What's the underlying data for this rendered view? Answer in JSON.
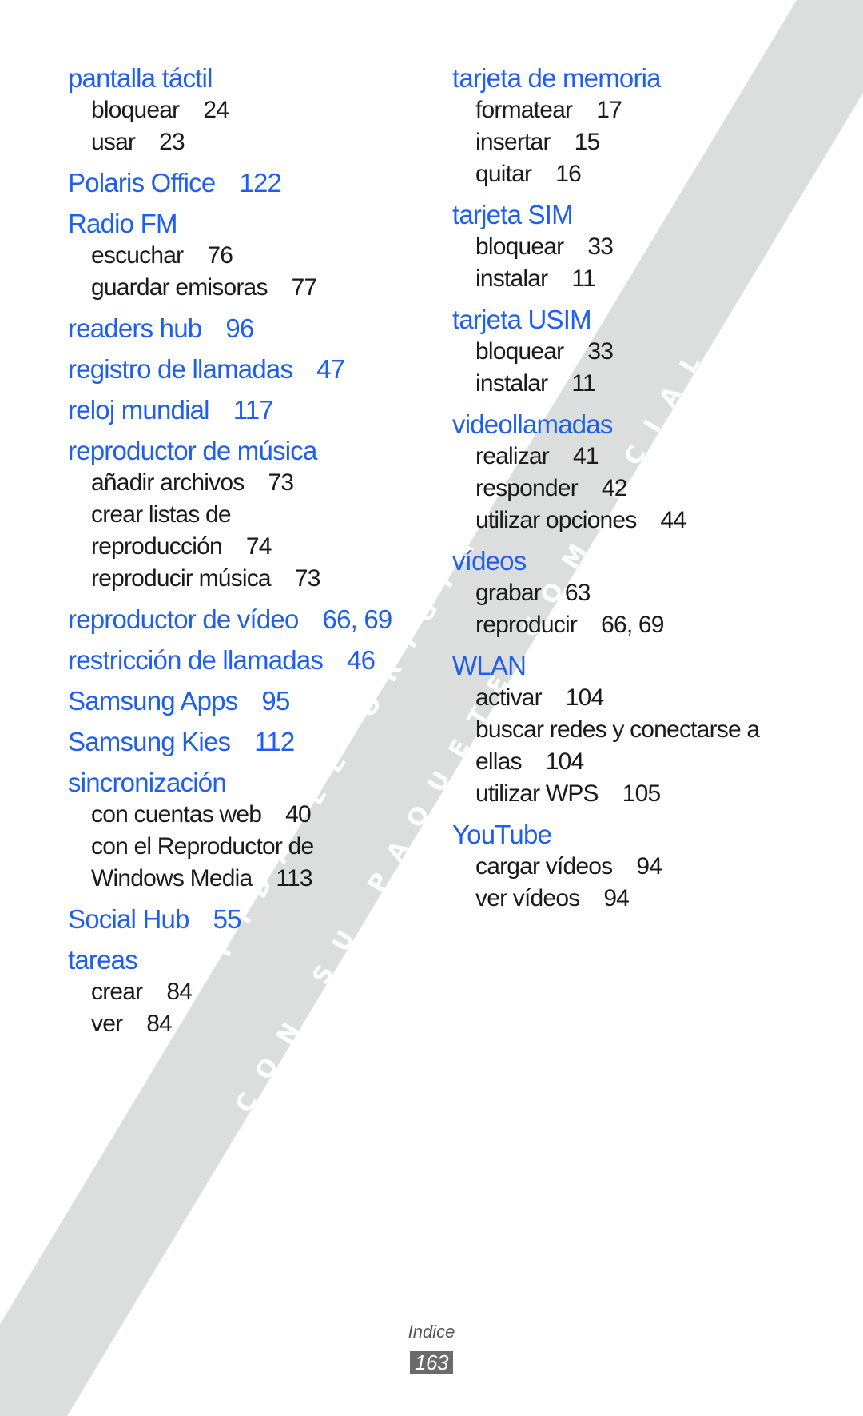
{
  "watermark": {
    "line1": "PIDA EL ORIGINAL",
    "line2": "CON SU PAQUETE COMERCIAL",
    "band_color": "#dcdddd"
  },
  "colors": {
    "heading": "#1f5ff0",
    "subentry": "#1a1a1a"
  },
  "index": {
    "left": [
      {
        "term": "pantalla táctil",
        "pages": "",
        "subs": [
          {
            "term": "bloquear",
            "pages": "24"
          },
          {
            "term": "usar",
            "pages": "23"
          }
        ]
      },
      {
        "term": "Polaris Office",
        "pages": "122",
        "subs": []
      },
      {
        "term": "Radio FM",
        "pages": "",
        "subs": [
          {
            "term": "escuchar",
            "pages": "76"
          },
          {
            "term": "guardar emisoras",
            "pages": "77"
          }
        ]
      },
      {
        "term": "readers hub",
        "pages": "96",
        "subs": []
      },
      {
        "term": "registro de llamadas",
        "pages": "47",
        "subs": []
      },
      {
        "term": "reloj mundial",
        "pages": "117",
        "subs": []
      },
      {
        "term": "reproductor de música",
        "pages": "",
        "subs": [
          {
            "term": "añadir archivos",
            "pages": "73"
          },
          {
            "term": "crear listas de reproducción",
            "pages": "74"
          },
          {
            "term": "reproducir música",
            "pages": "73"
          }
        ]
      },
      {
        "term": "reproductor de vídeo",
        "pages": "66, 69",
        "subs": []
      },
      {
        "term": "restricción de llamadas",
        "pages": "46",
        "subs": []
      },
      {
        "term": "Samsung Apps",
        "pages": "95",
        "subs": []
      },
      {
        "term": "Samsung Kies",
        "pages": "112",
        "subs": []
      },
      {
        "term": "sincronización",
        "pages": "",
        "subs": [
          {
            "term": "con cuentas web",
            "pages": "40"
          },
          {
            "term": "con el Reproductor de Windows Media",
            "pages": "113"
          }
        ]
      },
      {
        "term": "Social Hub",
        "pages": "55",
        "subs": []
      },
      {
        "term": "tareas",
        "pages": "",
        "subs": [
          {
            "term": "crear",
            "pages": "84"
          },
          {
            "term": "ver",
            "pages": "84"
          }
        ]
      }
    ],
    "right": [
      {
        "term": "tarjeta de memoria",
        "pages": "",
        "subs": [
          {
            "term": "formatear",
            "pages": "17"
          },
          {
            "term": "insertar",
            "pages": "15"
          },
          {
            "term": "quitar",
            "pages": "16"
          }
        ]
      },
      {
        "term": "tarjeta SIM",
        "pages": "",
        "subs": [
          {
            "term": "bloquear",
            "pages": "33"
          },
          {
            "term": "instalar",
            "pages": "11"
          }
        ]
      },
      {
        "term": "tarjeta USIM",
        "pages": "",
        "subs": [
          {
            "term": "bloquear",
            "pages": "33"
          },
          {
            "term": "instalar",
            "pages": "11"
          }
        ]
      },
      {
        "term": "videollamadas",
        "pages": "",
        "subs": [
          {
            "term": "realizar",
            "pages": "41"
          },
          {
            "term": "responder",
            "pages": "42"
          },
          {
            "term": "utilizar opciones",
            "pages": "44"
          }
        ]
      },
      {
        "term": "vídeos",
        "pages": "",
        "subs": [
          {
            "term": "grabar",
            "pages": "63"
          },
          {
            "term": "reproducir",
            "pages": "66, 69"
          }
        ]
      },
      {
        "term": "WLAN",
        "pages": "",
        "subs": [
          {
            "term": "activar",
            "pages": "104"
          },
          {
            "term": "buscar redes y conectarse a ellas",
            "pages": "104"
          },
          {
            "term": "utilizar WPS",
            "pages": "105"
          }
        ]
      },
      {
        "term": "YouTube",
        "pages": "",
        "subs": [
          {
            "term": "cargar vídeos",
            "pages": "94"
          },
          {
            "term": "ver vídeos",
            "pages": "94"
          }
        ]
      }
    ]
  },
  "footer": {
    "section": "Indice",
    "page_number": "163"
  }
}
